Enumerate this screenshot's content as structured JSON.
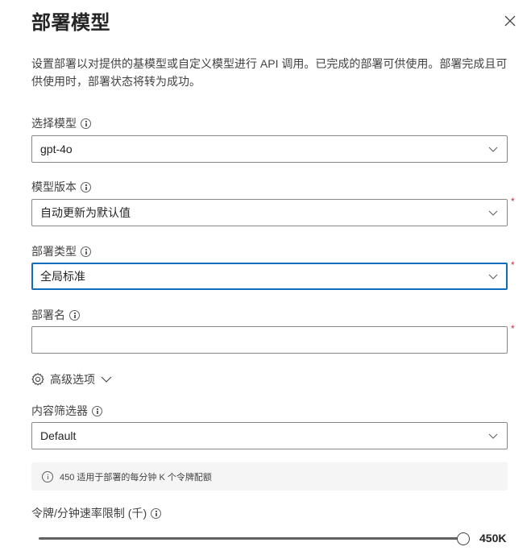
{
  "panel": {
    "title": "部署模型",
    "description": "设置部署以对提供的基模型或自定义模型进行 API 调用。已完成的部署可供使用。部署完成且可供使用时，部署状态将转为成功。"
  },
  "fields": {
    "model": {
      "label": "选择模型",
      "value": "gpt-4o",
      "required": false
    },
    "version": {
      "label": "模型版本",
      "value": "自动更新为默认值",
      "required": true
    },
    "deployment_type": {
      "label": "部署类型",
      "value": "全局标准",
      "required": true,
      "focused": true
    },
    "deployment_name": {
      "label": "部署名",
      "value": "",
      "required": true
    },
    "content_filter": {
      "label": "内容筛选器",
      "value": "Default",
      "required": false
    }
  },
  "advanced": {
    "label": "高级选项"
  },
  "notice": {
    "text": "450 适用于部署的每分钟 K 个令牌配额"
  },
  "rate_limit": {
    "label": "令牌/分钟速率限制 (千)",
    "value_text": "450K",
    "value": 450,
    "max": 450,
    "fraction": 1.0
  },
  "required_mark": "*",
  "icons": {
    "close": "close-icon",
    "info": "info-icon",
    "chevron": "chevron-down-icon",
    "settings": "gear-icon"
  },
  "colors": {
    "focus": "#0f6cbd",
    "required": "#c4314b",
    "notice_bg": "#f5f5f5"
  }
}
